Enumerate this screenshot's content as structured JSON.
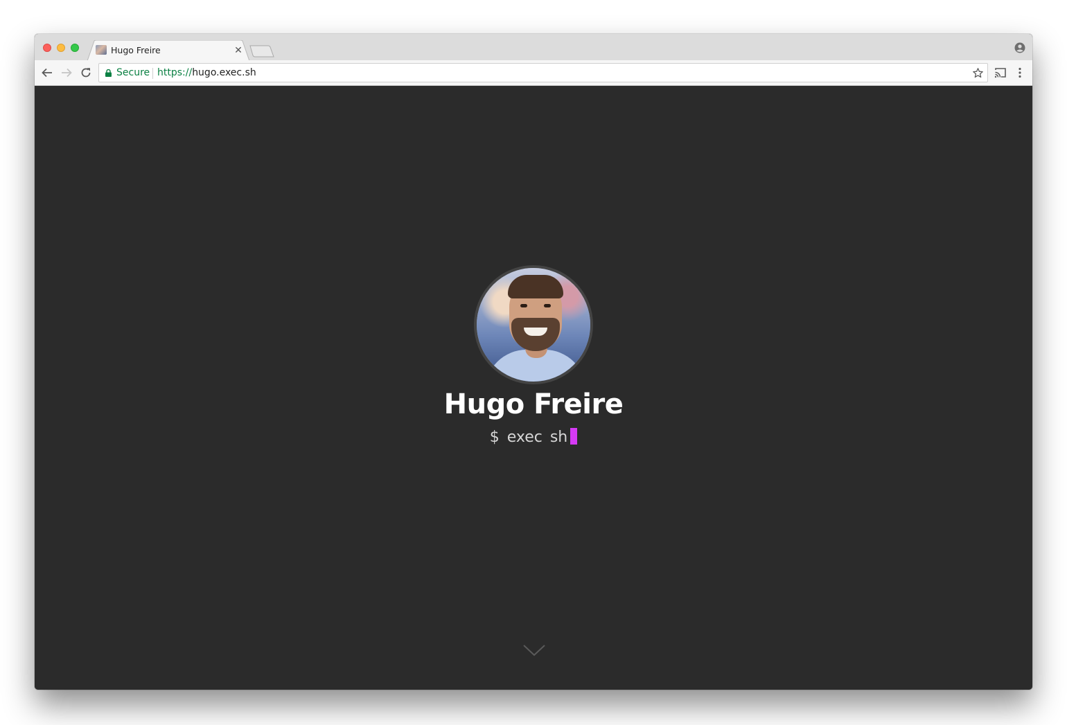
{
  "browser": {
    "tab": {
      "title": "Hugo Freire",
      "favicon": "profile-photo-favicon"
    },
    "address_bar": {
      "security_label": "Secure",
      "url_scheme": "https://",
      "url_host": "hugo.exec.sh"
    },
    "icons": {
      "back": "arrow-left-icon",
      "forward": "arrow-right-icon",
      "reload": "reload-icon",
      "lock": "lock-icon",
      "bookmark": "star-icon",
      "cast": "cast-icon",
      "menu": "kebab-menu-icon",
      "profile": "profile-icon",
      "close_tab": "close-icon"
    }
  },
  "page": {
    "name": "Hugo Freire",
    "prompt": "$ exec sh",
    "cursor_color": "#d63af5",
    "background": "#2b2b2b",
    "scroll_hint_icon": "chevron-down-icon"
  }
}
